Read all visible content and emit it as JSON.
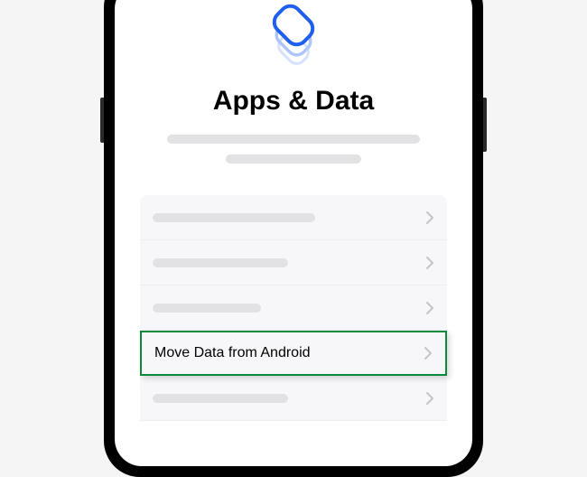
{
  "page": {
    "title": "Apps & Data"
  },
  "options": {
    "move_from_android": "Move Data from Android"
  }
}
